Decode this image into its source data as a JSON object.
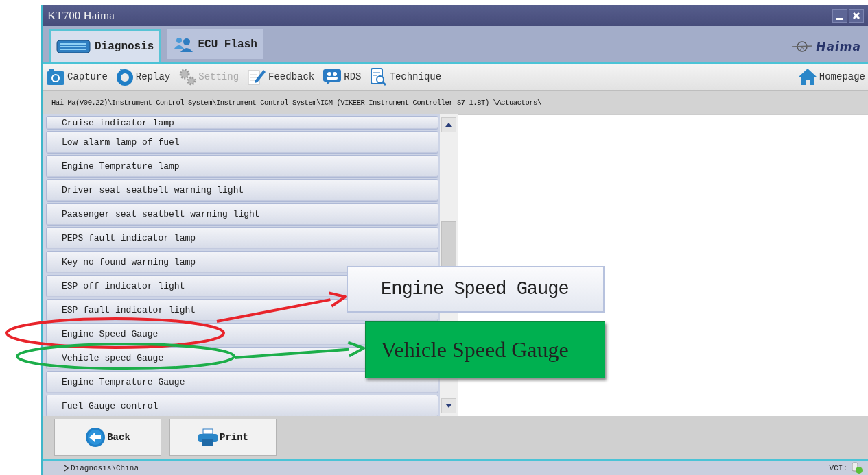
{
  "window": {
    "title": "KT700 Haima"
  },
  "tabs": [
    {
      "label": "Diagnosis",
      "selected": true,
      "kind": "diagnosis"
    },
    {
      "label": "ECU Flash",
      "selected": false,
      "kind": "flash"
    }
  ],
  "brand": {
    "logo_text": "Haima"
  },
  "toolbar": [
    {
      "label": "Capture",
      "kind": "camera",
      "disabled": false
    },
    {
      "label": "Replay",
      "kind": "replay",
      "disabled": false
    },
    {
      "label": "Setting",
      "kind": "gear",
      "disabled": true
    },
    {
      "label": "Feedback",
      "kind": "feedback",
      "disabled": false
    },
    {
      "label": "RDS",
      "kind": "rds",
      "disabled": false
    },
    {
      "label": "Technique",
      "kind": "technique",
      "disabled": false
    }
  ],
  "homepage": {
    "label": "Homepage"
  },
  "breadcrumb": "Hai Ma(V00.22)\\Instrument Control System\\Instrument Control System\\ICM (VIKEER-Instrument Controller-S7 1.8T) \\Actuactors\\",
  "list": {
    "items": [
      "Cruise indicator lamp",
      "Low alarm lamp of fuel",
      "Engine Temprature lamp",
      "Driver seat seatbelt warning light",
      "Paasenger seat seatbelt warning light",
      "PEPS fault indicator lamp",
      "Key no found warning lamp",
      "ESP off indicator light",
      "ESP fault indicator light",
      "Engine Speed Gauge",
      "Vehicle speed Gauge",
      "Engine Temprature Gauge",
      "Fuel Gauge control"
    ]
  },
  "buttons": [
    {
      "label": "Back",
      "kind": "back"
    },
    {
      "label": "Print",
      "kind": "print"
    }
  ],
  "status_bar": {
    "path": "Diagnosis\\China",
    "vci_label": "VCI:"
  },
  "annotations": [
    {
      "text": "Engine Speed Gauge",
      "kind": "plain",
      "color": "#e8242b"
    },
    {
      "text": "Vehicle Speed Gauge",
      "kind": "filled",
      "color": "#1cae4a"
    }
  ]
}
